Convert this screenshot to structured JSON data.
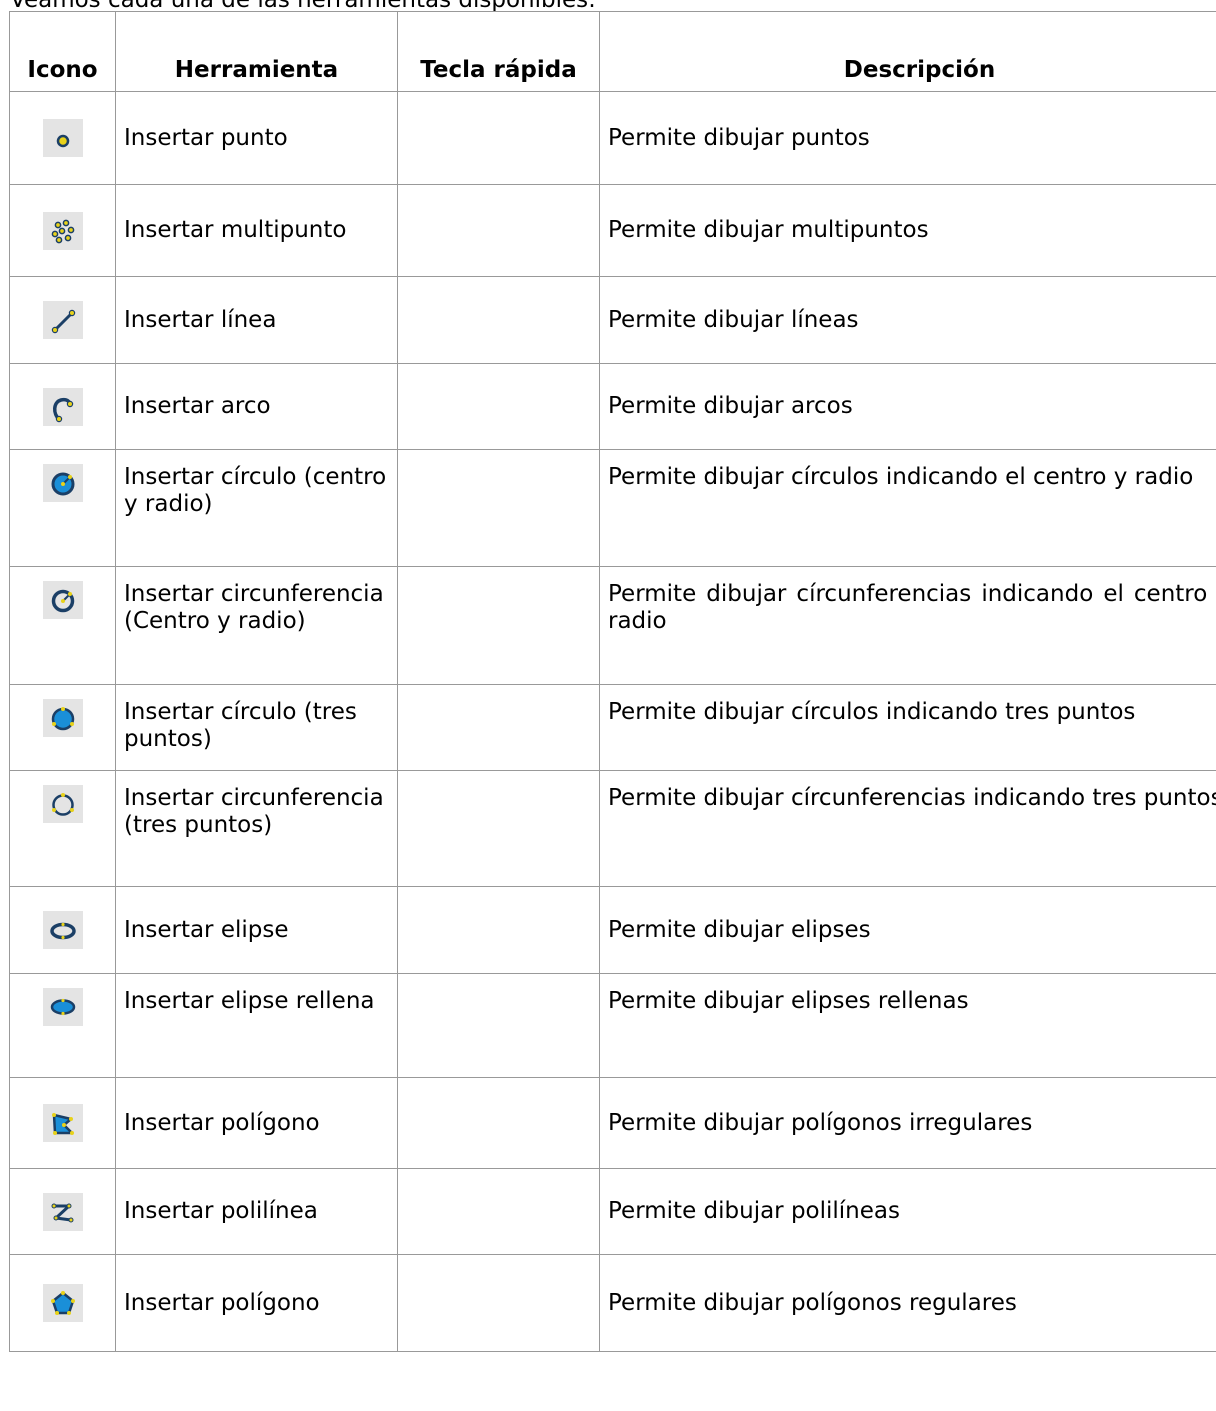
{
  "intro": "Veamos cada una de las herramientas disponibles:",
  "headers": [
    "Icono",
    "Herramienta",
    "Tecla rápida",
    "Descripción"
  ],
  "rows": [
    {
      "icon": "point-icon",
      "tool": "Insertar punto",
      "key": "",
      "desc": "Permite dibujar puntos"
    },
    {
      "icon": "multipoint-icon",
      "tool": "Insertar multipunto",
      "key": "",
      "desc": "Permite dibujar multipuntos"
    },
    {
      "icon": "line-icon",
      "tool": "Insertar línea",
      "key": "",
      "desc": "Permite dibujar líneas"
    },
    {
      "icon": "arc-icon",
      "tool": "Insertar arco",
      "key": "",
      "desc": "Permite dibujar arcos"
    },
    {
      "icon": "circle-center-radius-icon",
      "tool": "Insertar círculo (centro y radio)",
      "key": "",
      "desc": "Permite dibujar círculos indicando el centro y radio"
    },
    {
      "icon": "circumference-center-radius-icon",
      "tool": "Insertar circunferencia (Centro y radio)",
      "key": "",
      "desc": "Permite dibujar círcunferencias indicando el centro y radio"
    },
    {
      "icon": "circle-three-points-icon",
      "tool": "Insertar círculo (tres puntos)",
      "key": "",
      "desc": "Permite dibujar círculos indicando tres puntos"
    },
    {
      "icon": "circumference-three-points-icon",
      "tool": "Insertar circunferencia (tres puntos)",
      "key": "",
      "desc": "Permite dibujar círcunferencias indicando tres puntos"
    },
    {
      "icon": "ellipse-icon",
      "tool": "Insertar elipse",
      "key": "",
      "desc": "Permite dibujar elipses"
    },
    {
      "icon": "filled-ellipse-icon",
      "tool": "Insertar elipse rellena",
      "key": "",
      "desc": "Permite dibujar elipses rellenas"
    },
    {
      "icon": "polygon-icon",
      "tool": "Insertar polígono",
      "key": "",
      "desc": "Permite dibujar polígonos irregulares"
    },
    {
      "icon": "polyline-icon",
      "tool": "Insertar polilínea",
      "key": "",
      "desc": "Permite dibujar polilíneas"
    },
    {
      "icon": "regular-polygon-icon",
      "tool": "Insertar polígono",
      "key": "",
      "desc": "Permite dibujar polígonos regulares"
    }
  ],
  "colors": {
    "icon_bg": "#e4e4e4",
    "icon_blue": "#1a8fd8",
    "icon_dark": "#1b3f66",
    "icon_yellow": "#e8d21a",
    "grid": "#999999"
  }
}
